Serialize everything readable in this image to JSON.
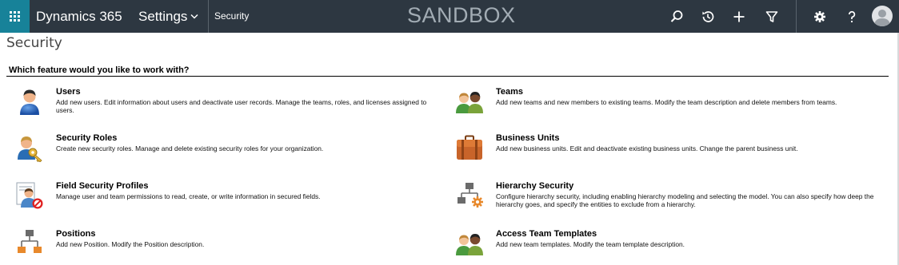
{
  "header": {
    "app_name": "Dynamics 365",
    "area": "Settings",
    "breadcrumb": "Security",
    "environment_label": "SANDBOX",
    "bar_color": "#2d3741",
    "waffle_color": "#178299",
    "icons": [
      "app-launcher-icon",
      "chevron-down-icon",
      "search-icon",
      "recent-icon",
      "add-icon",
      "filter-icon",
      "gear-icon",
      "help-icon",
      "user-avatar-icon"
    ]
  },
  "page": {
    "title": "Security",
    "section_heading": "Which feature would you like to work with?"
  },
  "features": [
    {
      "key": "users",
      "icon": "user-icon",
      "title": "Users",
      "description": "Add new users. Edit information about users and deactivate user records. Manage the teams, roles, and licenses assigned to users."
    },
    {
      "key": "teams",
      "icon": "team-icon",
      "title": "Teams",
      "description": "Add new teams and new members to existing teams. Modify the team description and delete members from teams."
    },
    {
      "key": "security_roles",
      "icon": "security-role-key-icon",
      "title": "Security Roles",
      "description": "Create new security roles. Manage and delete existing security roles for your organization."
    },
    {
      "key": "business_units",
      "icon": "briefcase-icon",
      "title": "Business Units",
      "description": "Add new business units. Edit and deactivate existing business units. Change the parent business unit."
    },
    {
      "key": "field_security_profiles",
      "icon": "field-security-profile-icon",
      "title": "Field Security Profiles",
      "description": "Manage user and team permissions to read, create, or write information in secured fields."
    },
    {
      "key": "hierarchy_security",
      "icon": "hierarchy-settings-icon",
      "title": "Hierarchy Security",
      "description": "Configure hierarchy security, including enabling hierarchy modeling and selecting the model. You can also specify how deep the hierarchy goes, and specify the entities to exclude from a hierarchy."
    },
    {
      "key": "positions",
      "icon": "org-chart-icon",
      "title": "Positions",
      "description": "Add new Position. Modify the Position description."
    },
    {
      "key": "access_team_templates",
      "icon": "team-template-icon",
      "title": "Access Team Templates",
      "description": "Add new team templates. Modify the team template description."
    }
  ]
}
